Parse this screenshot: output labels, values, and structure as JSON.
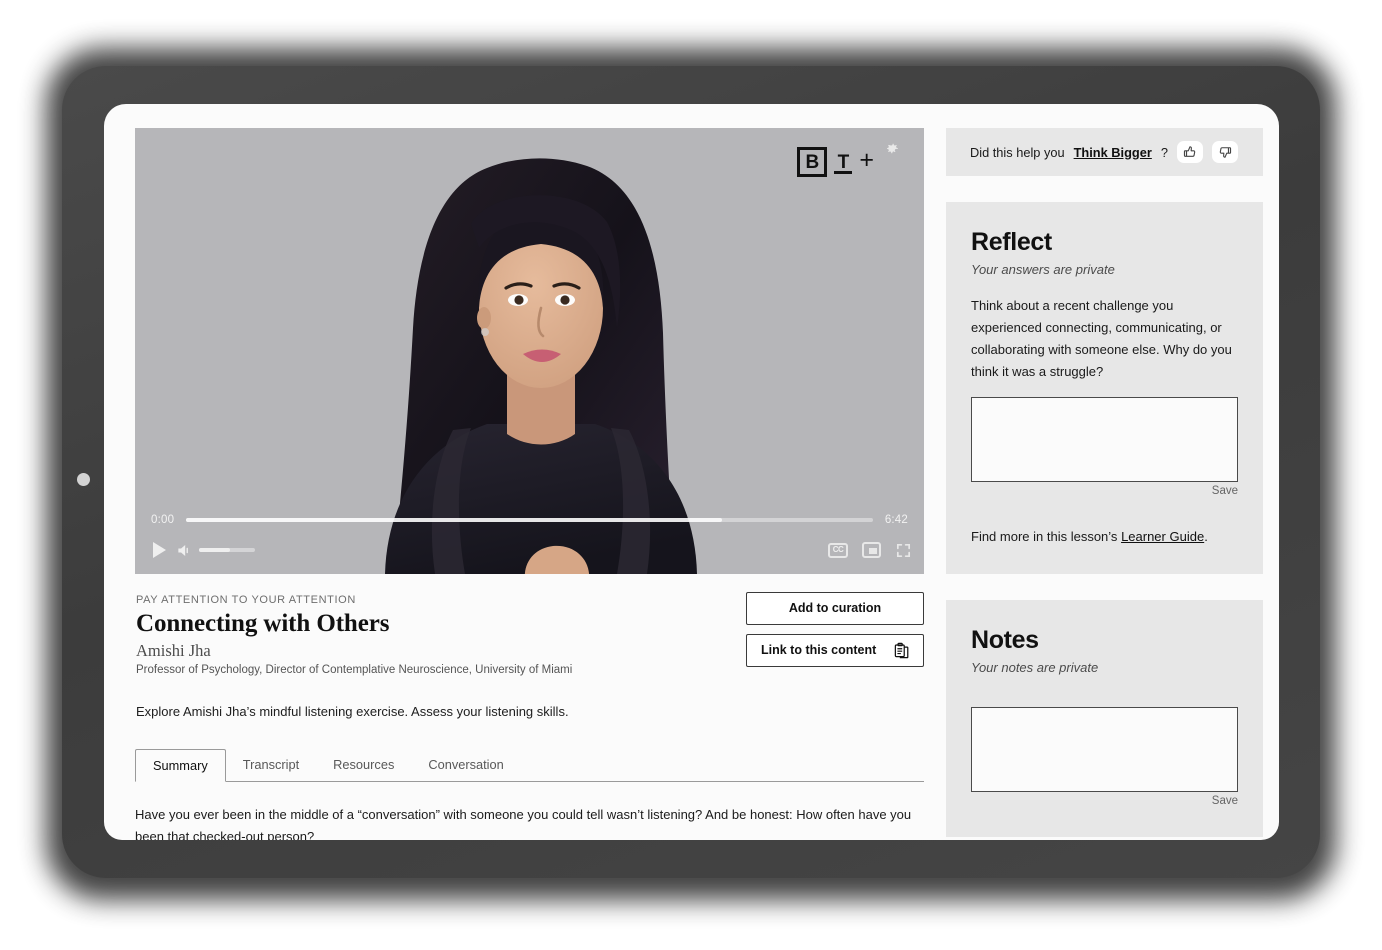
{
  "video": {
    "logo": {
      "b": "B",
      "t": "T",
      "plus": "+",
      "name": "big-think-plus-logo"
    },
    "settings_icon": "gear-icon",
    "current_time": "0:00",
    "duration": "6:42",
    "cc_label": "CC",
    "progress_percent": 0,
    "buffered_percent": 78,
    "volume_percent": 56
  },
  "lesson": {
    "eyebrow": "PAY ATTENTION TO YOUR ATTENTION",
    "title": "Connecting with Others",
    "speaker": "Amishi Jha",
    "speaker_role": "Professor of Psychology, Director of Contemplative Neuroscience, University of Miami",
    "description": "Explore Amishi Jha’s mindful listening exercise. Assess your listening skills."
  },
  "actions": {
    "add_to_curation": "Add to curation",
    "link_to_content": "Link to this content"
  },
  "tabs": [
    {
      "label": "Summary",
      "active": true
    },
    {
      "label": "Transcript",
      "active": false
    },
    {
      "label": "Resources",
      "active": false
    },
    {
      "label": "Conversation",
      "active": false
    }
  ],
  "tab_body": "Have you ever been in the middle of a “conversation” with someone you could tell wasn’t listening? And be honest: How often have you been that checked-out person?",
  "feedback": {
    "question_pre": "Did this help you",
    "link": "Think Bigger",
    "question_post": "?",
    "thumbs_up": "thumbs-up-icon",
    "thumbs_down": "thumbs-down-icon"
  },
  "reflect": {
    "heading": "Reflect",
    "subtitle": "Your answers are private",
    "prompt": "Think about a recent challenge you experienced connecting, communicating, or collaborating with someone else. Why do you think it was a struggle?",
    "answer_value": "",
    "save_label": "Save",
    "find_more_pre": "Find more in this lesson’s",
    "find_more_link": "Learner Guide",
    "find_more_post": "."
  },
  "notes": {
    "heading": "Notes",
    "subtitle": "Your notes are private",
    "value": "",
    "save_label": "Save"
  },
  "colors": {
    "panel_bg": "#e7e7e7",
    "screen_bg": "#fbfbfb",
    "frame": "#414141",
    "video_bg": "#b6b6b9"
  }
}
